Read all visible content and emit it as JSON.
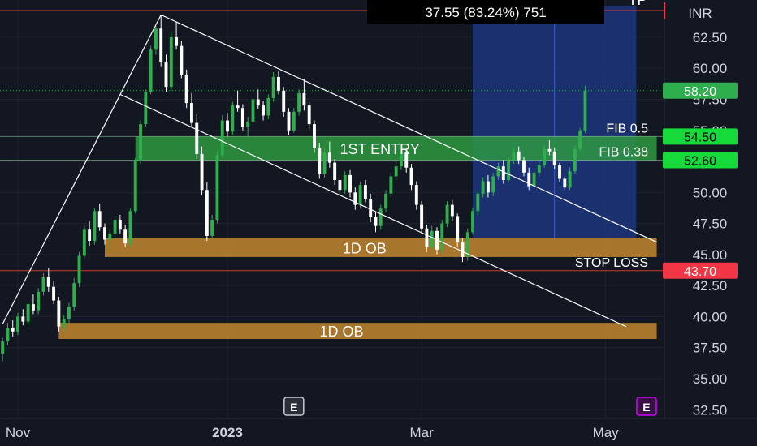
{
  "currency": "INR",
  "top_label": "TP",
  "measure_readout": "37.55 (83.24%) 751",
  "earnings_badge": "E",
  "colors": {
    "background": "#131722",
    "axis_text": "#d1d4dc",
    "grid": "#1e222d",
    "candle_up": "#2fae4e",
    "candle_down": "#ffffff",
    "zone_green": "#2e9e3f",
    "zone_orange": "#c98a2e",
    "target_box": "#1f3a8a",
    "stop_line": "#e53935",
    "tag_green": "#16d93a",
    "tag_red": "#f23645",
    "trendline": "#ffffff"
  },
  "chart_data": {
    "type": "candlestick",
    "title": "",
    "y_ticks": [
      "62.50",
      "60.00",
      "57.50",
      "55.00",
      "52.50",
      "50.00",
      "47.50",
      "45.00",
      "42.50",
      "40.00",
      "37.50",
      "35.00",
      "32.50"
    ],
    "y_tick_values": [
      62.5,
      60.0,
      57.5,
      55.0,
      52.5,
      50.0,
      47.5,
      45.0,
      42.5,
      40.0,
      37.5,
      35.0,
      32.5
    ],
    "ylim": [
      31.8,
      65.5
    ],
    "x_ticks": [
      {
        "label": "Nov",
        "bar": 3
      },
      {
        "label": "2023",
        "bar": 44
      },
      {
        "label": "Mar",
        "bar": 82
      },
      {
        "label": "May",
        "bar": 118
      }
    ],
    "bar_count": 130,
    "price_tags": [
      {
        "label": "58.20",
        "value": 58.2,
        "color": "#2fae4e",
        "text_color": "#ffffff"
      },
      {
        "label": "54.50",
        "value": 54.5,
        "color": "#16d93a",
        "text_color": "#000000"
      },
      {
        "label": "52.60",
        "value": 52.6,
        "color": "#16d93a",
        "text_color": "#000000"
      },
      {
        "label": "43.70",
        "value": 43.7,
        "color": "#f23645",
        "text_color": "#ffffff"
      }
    ],
    "zones": [
      {
        "label": "1ST ENTRY",
        "top": 54.5,
        "bottom": 52.6,
        "from_bar": 26,
        "to_bar": 128,
        "color": "#2e9e3f"
      },
      {
        "label": "1D OB",
        "top": 46.3,
        "bottom": 44.8,
        "from_bar": 20,
        "to_bar": 128,
        "color": "#c98a2e"
      },
      {
        "label": "1D OB",
        "top": 39.5,
        "bottom": 38.2,
        "from_bar": 11,
        "to_bar": 128,
        "color": "#c98a2e"
      }
    ],
    "target_box": {
      "top": 65.0,
      "bottom": 46.3,
      "from_bar": 92,
      "to_bar": 124,
      "divider_bar": 108
    },
    "levels": [
      {
        "label": "FIB 0.5",
        "value": 54.5
      },
      {
        "label": "FIB 0.38",
        "value": 52.6
      },
      {
        "label": "STOP LOSS",
        "value": 43.7
      }
    ],
    "trendlines": [
      {
        "from": [
          0,
          39.4
        ],
        "to": [
          31,
          64.3
        ]
      },
      {
        "from": [
          31,
          64.3
        ],
        "to": [
          128,
          46.0
        ]
      },
      {
        "from": [
          23,
          57.9
        ],
        "to": [
          122,
          39.2
        ]
      }
    ],
    "earnings_markers": [
      {
        "bar": 57,
        "highlight": false
      },
      {
        "bar": 126,
        "highlight": true
      }
    ],
    "candles": [
      [
        37.0,
        38.3,
        36.4,
        38.0
      ],
      [
        38.0,
        39.5,
        37.7,
        39.1
      ],
      [
        39.1,
        39.7,
        38.4,
        38.8
      ],
      [
        38.8,
        40.3,
        38.5,
        40.0
      ],
      [
        40.0,
        40.6,
        39.3,
        39.6
      ],
      [
        39.6,
        41.2,
        39.3,
        41.0
      ],
      [
        41.0,
        41.8,
        40.2,
        40.5
      ],
      [
        40.5,
        42.3,
        40.2,
        42.0
      ],
      [
        42.0,
        43.5,
        41.7,
        43.2
      ],
      [
        43.2,
        43.9,
        42.0,
        42.4
      ],
      [
        42.4,
        42.9,
        41.0,
        41.3
      ],
      [
        41.3,
        41.6,
        38.8,
        39.2
      ],
      [
        39.2,
        40.1,
        38.9,
        39.8
      ],
      [
        39.8,
        41.1,
        39.5,
        40.8
      ],
      [
        40.8,
        43.1,
        40.5,
        42.7
      ],
      [
        42.7,
        45.2,
        42.4,
        44.9
      ],
      [
        44.9,
        47.3,
        44.7,
        47.0
      ],
      [
        47.0,
        47.7,
        45.7,
        46.1
      ],
      [
        46.1,
        48.7,
        45.8,
        48.5
      ],
      [
        48.5,
        49.1,
        46.9,
        47.2
      ],
      [
        47.2,
        47.5,
        45.8,
        46.2
      ],
      [
        46.2,
        47.0,
        45.3,
        46.7
      ],
      [
        46.7,
        48.1,
        46.4,
        47.8
      ],
      [
        47.8,
        48.2,
        46.7,
        47.0
      ],
      [
        47.0,
        47.4,
        45.6,
        45.9
      ],
      [
        45.9,
        48.7,
        45.7,
        48.5
      ],
      [
        48.5,
        52.8,
        48.3,
        52.6
      ],
      [
        52.6,
        55.8,
        52.3,
        55.5
      ],
      [
        55.5,
        58.3,
        55.3,
        58.1
      ],
      [
        58.1,
        61.8,
        57.9,
        61.5
      ],
      [
        61.5,
        63.4,
        61.1,
        63.2
      ],
      [
        63.2,
        64.3,
        60.1,
        60.5
      ],
      [
        60.5,
        61.1,
        58.1,
        58.5
      ],
      [
        58.5,
        62.9,
        58.2,
        62.5
      ],
      [
        62.5,
        63.7,
        61.5,
        61.8
      ],
      [
        61.8,
        62.2,
        59.2,
        59.5
      ],
      [
        59.5,
        59.9,
        56.8,
        57.2
      ],
      [
        57.2,
        58.0,
        55.2,
        55.6
      ],
      [
        55.6,
        56.3,
        52.7,
        53.1
      ],
      [
        53.1,
        53.7,
        49.8,
        50.2
      ],
      [
        50.2,
        50.8,
        46.1,
        46.5
      ],
      [
        46.5,
        48.2,
        46.2,
        47.8
      ],
      [
        47.8,
        53.3,
        47.5,
        53.0
      ],
      [
        53.0,
        56.2,
        52.8,
        55.8
      ],
      [
        55.8,
        56.4,
        54.5,
        54.9
      ],
      [
        54.9,
        57.3,
        54.6,
        57.0
      ],
      [
        57.0,
        58.2,
        56.5,
        56.8
      ],
      [
        56.8,
        57.1,
        55.0,
        55.3
      ],
      [
        55.3,
        56.1,
        54.4,
        55.7
      ],
      [
        55.7,
        57.8,
        55.4,
        57.5
      ],
      [
        57.5,
        58.3,
        56.7,
        57.0
      ],
      [
        57.0,
        57.4,
        55.8,
        56.2
      ],
      [
        56.2,
        57.9,
        55.9,
        57.6
      ],
      [
        57.6,
        59.7,
        57.3,
        59.3
      ],
      [
        59.3,
        59.8,
        57.9,
        58.2
      ],
      [
        58.2,
        58.5,
        56.1,
        56.5
      ],
      [
        56.5,
        56.8,
        54.6,
        55.0
      ],
      [
        55.0,
        56.8,
        54.8,
        56.5
      ],
      [
        56.5,
        58.3,
        56.2,
        58.0
      ],
      [
        58.0,
        59.1,
        56.6,
        57.0
      ],
      [
        57.0,
        57.3,
        55.1,
        55.5
      ],
      [
        55.5,
        55.8,
        53.2,
        53.6
      ],
      [
        53.6,
        54.0,
        51.1,
        51.5
      ],
      [
        51.5,
        53.5,
        51.2,
        53.2
      ],
      [
        53.2,
        54.1,
        52.0,
        52.4
      ],
      [
        52.4,
        52.7,
        50.6,
        51.0
      ],
      [
        51.0,
        51.4,
        49.8,
        50.2
      ],
      [
        50.2,
        51.7,
        49.9,
        51.4
      ],
      [
        51.4,
        51.8,
        49.6,
        50.0
      ],
      [
        50.0,
        50.4,
        48.6,
        49.0
      ],
      [
        49.0,
        50.9,
        48.7,
        50.6
      ],
      [
        50.6,
        51.0,
        49.2,
        49.5
      ],
      [
        49.5,
        49.9,
        47.6,
        48.0
      ],
      [
        48.0,
        48.4,
        46.8,
        47.3
      ],
      [
        47.3,
        49.0,
        47.0,
        48.7
      ],
      [
        48.7,
        50.2,
        48.4,
        49.9
      ],
      [
        49.9,
        51.6,
        49.6,
        51.3
      ],
      [
        51.3,
        52.5,
        51.0,
        52.1
      ],
      [
        52.1,
        53.6,
        51.8,
        53.2
      ],
      [
        53.2,
        53.5,
        51.6,
        52.0
      ],
      [
        52.0,
        52.3,
        50.2,
        50.6
      ],
      [
        50.6,
        50.9,
        48.6,
        49.0
      ],
      [
        49.0,
        49.3,
        46.7,
        47.1
      ],
      [
        47.1,
        47.4,
        45.2,
        45.6
      ],
      [
        45.6,
        47.3,
        45.2,
        46.9
      ],
      [
        46.9,
        47.2,
        45.0,
        45.4
      ],
      [
        45.4,
        47.8,
        45.1,
        47.5
      ],
      [
        47.5,
        49.3,
        47.2,
        49.0
      ],
      [
        49.0,
        49.4,
        47.7,
        48.1
      ],
      [
        48.1,
        48.3,
        45.6,
        46.0
      ],
      [
        46.0,
        46.3,
        44.4,
        44.8
      ],
      [
        44.8,
        47.1,
        44.5,
        46.8
      ],
      [
        46.8,
        48.8,
        46.6,
        48.5
      ],
      [
        48.5,
        50.2,
        48.2,
        49.9
      ],
      [
        49.9,
        51.2,
        49.6,
        50.9
      ],
      [
        50.9,
        51.4,
        49.6,
        50.0
      ],
      [
        50.0,
        51.6,
        49.7,
        51.3
      ],
      [
        51.3,
        52.4,
        51.0,
        52.1
      ],
      [
        52.1,
        52.6,
        50.7,
        51.0
      ],
      [
        51.0,
        52.9,
        50.8,
        52.6
      ],
      [
        52.6,
        53.6,
        52.3,
        53.3
      ],
      [
        53.3,
        53.7,
        52.3,
        52.6
      ],
      [
        52.6,
        52.9,
        51.3,
        51.6
      ],
      [
        51.6,
        52.0,
        50.2,
        50.5
      ],
      [
        50.5,
        51.9,
        50.3,
        51.6
      ],
      [
        51.6,
        52.5,
        51.3,
        52.2
      ],
      [
        52.2,
        53.8,
        52.0,
        53.5
      ],
      [
        53.5,
        54.2,
        53.0,
        53.3
      ],
      [
        53.3,
        53.6,
        51.9,
        52.2
      ],
      [
        52.2,
        52.4,
        50.8,
        51.1
      ],
      [
        51.1,
        51.3,
        50.1,
        50.4
      ],
      [
        50.4,
        52.0,
        50.2,
        51.7
      ],
      [
        51.7,
        53.8,
        51.5,
        53.5
      ],
      [
        53.5,
        55.2,
        53.3,
        55.0
      ],
      [
        55.0,
        58.6,
        54.8,
        58.2
      ]
    ]
  }
}
